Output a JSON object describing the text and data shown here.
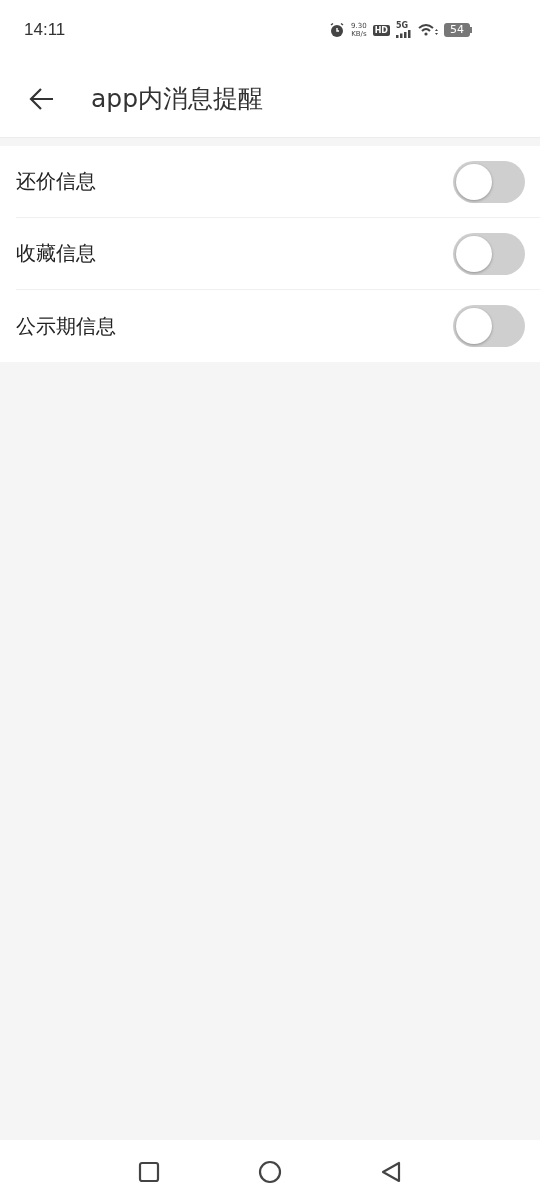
{
  "status_bar": {
    "time": "14:11",
    "speed_value": "9.30",
    "speed_unit": "KB/s",
    "hd_badge": "HD",
    "network": "5G",
    "battery": "54"
  },
  "header": {
    "title": "app内消息提醒"
  },
  "settings": [
    {
      "label": "还价信息",
      "on": false
    },
    {
      "label": "收藏信息",
      "on": false
    },
    {
      "label": "公示期信息",
      "on": false
    }
  ]
}
